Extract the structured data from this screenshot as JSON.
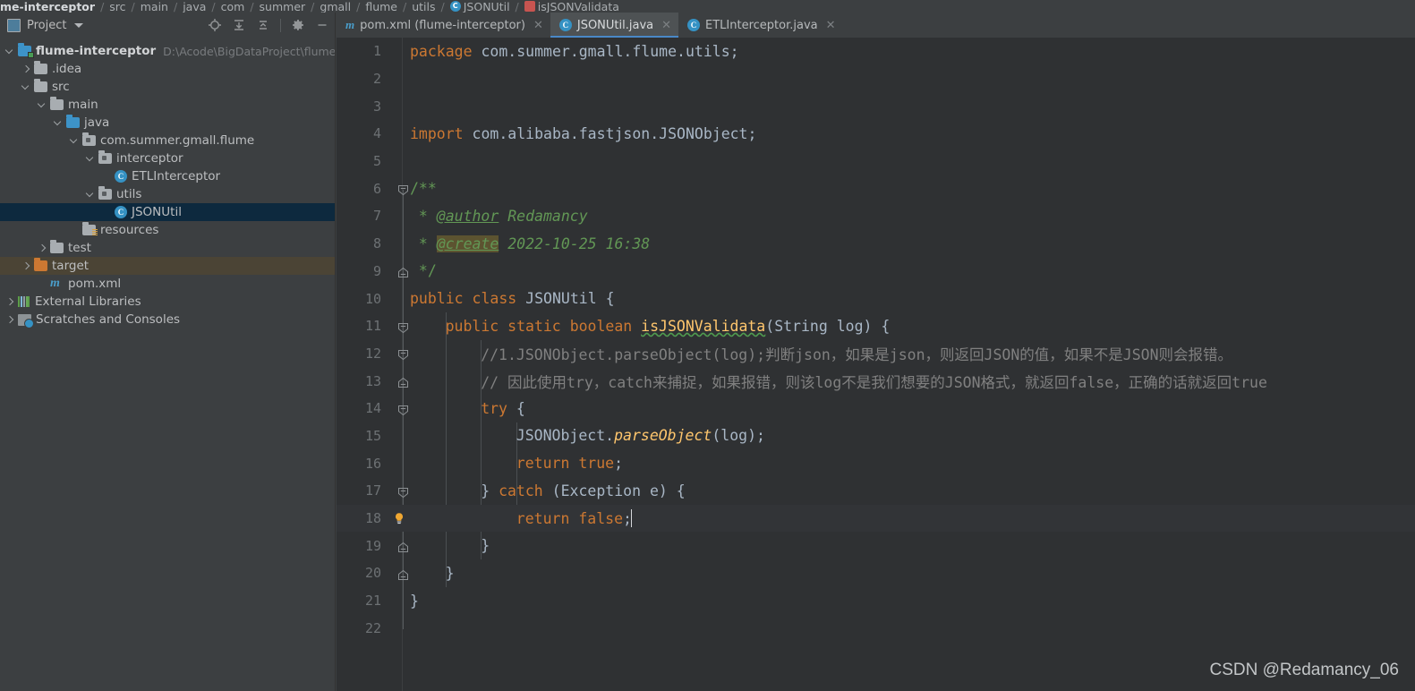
{
  "breadcrumb": {
    "items": [
      {
        "label": "me-interceptor",
        "bold": true,
        "icon": ""
      },
      {
        "label": "src",
        "icon": ""
      },
      {
        "label": "main",
        "icon": ""
      },
      {
        "label": "java",
        "icon": ""
      },
      {
        "label": "com",
        "icon": ""
      },
      {
        "label": "summer",
        "icon": ""
      },
      {
        "label": "gmall",
        "icon": ""
      },
      {
        "label": "flume",
        "icon": ""
      },
      {
        "label": "utils",
        "icon": ""
      },
      {
        "label": "JSONUtil",
        "icon": "class-icon"
      },
      {
        "label": "isJSONValidata",
        "icon": "method-icon"
      }
    ],
    "separator": "/"
  },
  "sidebar": {
    "panel_title": "Project",
    "tools": [
      {
        "name": "locate-icon",
        "title": "Select Opened File"
      },
      {
        "name": "expand-all-icon",
        "title": "Expand All"
      },
      {
        "name": "collapse-all-icon",
        "title": "Collapse All"
      },
      {
        "name": "gear-icon",
        "title": "Settings"
      },
      {
        "name": "minimize-icon",
        "title": "Hide"
      }
    ],
    "tree": [
      {
        "label": "flume-interceptor",
        "path": "D:\\Acode\\BigDataProject\\flume-interce",
        "indent": 0,
        "arrow": "down",
        "icon": "module-folder-icon",
        "bold": true,
        "state": "normal"
      },
      {
        "label": ".idea",
        "path": "",
        "indent": 1,
        "arrow": "right",
        "icon": "folder-icon",
        "bold": false,
        "state": "normal"
      },
      {
        "label": "src",
        "path": "",
        "indent": 1,
        "arrow": "down",
        "icon": "folder-icon",
        "bold": false,
        "state": "normal"
      },
      {
        "label": "main",
        "path": "",
        "indent": 2,
        "arrow": "down",
        "icon": "folder-icon",
        "bold": false,
        "state": "normal"
      },
      {
        "label": "java",
        "path": "",
        "indent": 3,
        "arrow": "down",
        "icon": "source-folder-icon",
        "bold": false,
        "state": "normal"
      },
      {
        "label": "com.summer.gmall.flume",
        "path": "",
        "indent": 4,
        "arrow": "down",
        "icon": "package-icon",
        "bold": false,
        "state": "normal"
      },
      {
        "label": "interceptor",
        "path": "",
        "indent": 5,
        "arrow": "down",
        "icon": "package-icon",
        "bold": false,
        "state": "normal"
      },
      {
        "label": "ETLInterceptor",
        "path": "",
        "indent": 6,
        "arrow": "none",
        "icon": "class-icon",
        "bold": false,
        "state": "normal"
      },
      {
        "label": "utils",
        "path": "",
        "indent": 5,
        "arrow": "down",
        "icon": "package-icon",
        "bold": false,
        "state": "normal"
      },
      {
        "label": "JSONUtil",
        "path": "",
        "indent": 6,
        "arrow": "none",
        "icon": "class-icon",
        "bold": false,
        "state": "selected"
      },
      {
        "label": "resources",
        "path": "",
        "indent": 4,
        "arrow": "none",
        "icon": "resources-folder-icon",
        "bold": false,
        "state": "normal"
      },
      {
        "label": "test",
        "path": "",
        "indent": 2,
        "arrow": "right",
        "icon": "folder-icon",
        "bold": false,
        "state": "normal"
      },
      {
        "label": "target",
        "path": "",
        "indent": 1,
        "arrow": "right",
        "icon": "target-folder-icon",
        "bold": false,
        "state": "context"
      },
      {
        "label": "pom.xml",
        "path": "",
        "indent": 2,
        "arrow": "none",
        "icon": "maven-icon",
        "bold": false,
        "state": "normal"
      },
      {
        "label": "External Libraries",
        "path": "",
        "indent": 0,
        "arrow": "right",
        "icon": "libraries-icon",
        "bold": false,
        "state": "normal"
      },
      {
        "label": "Scratches and Consoles",
        "path": "",
        "indent": 0,
        "arrow": "right",
        "icon": "scratches-icon",
        "bold": false,
        "state": "normal"
      }
    ]
  },
  "editor": {
    "tabs": [
      {
        "label": "pom.xml (flume-interceptor)",
        "icon": "maven-icon",
        "active": false,
        "closable": true
      },
      {
        "label": "JSONUtil.java",
        "icon": "class-icon",
        "active": true,
        "closable": true
      },
      {
        "label": "ETLInterceptor.java",
        "icon": "class-icon",
        "active": false,
        "closable": true
      }
    ],
    "current_line": 18,
    "caret_after": "return false;",
    "lines": [
      {
        "n": "1",
        "fold": "none",
        "text": "package com.summer.gmall.flume.utils;"
      },
      {
        "n": "2",
        "fold": "none",
        "text": ""
      },
      {
        "n": "3",
        "fold": "none",
        "text": ""
      },
      {
        "n": "4",
        "fold": "none",
        "text": "import com.alibaba.fastjson.JSONObject;"
      },
      {
        "n": "5",
        "fold": "none",
        "text": ""
      },
      {
        "n": "6",
        "fold": "start",
        "text": "/**"
      },
      {
        "n": "7",
        "fold": "none",
        "text": " * @author Redamancy"
      },
      {
        "n": "8",
        "fold": "none",
        "text": " * @create 2022-10-25 16:38"
      },
      {
        "n": "9",
        "fold": "end",
        "text": " */"
      },
      {
        "n": "10",
        "fold": "none",
        "text": "public class JSONUtil {"
      },
      {
        "n": "11",
        "fold": "start",
        "text": "    public static boolean isJSONValidata(String log) {"
      },
      {
        "n": "12",
        "fold": "start",
        "text": "        //1.JSONObject.parseObject(log);判断json，如果是json，则返回JSON的值，如果不是JSON则会报错。"
      },
      {
        "n": "13",
        "fold": "end",
        "text": "        // 因此使用try，catch来捕捉，如果报错，则该log不是我们想要的JSON格式，就返回false，正确的话就返回true"
      },
      {
        "n": "14",
        "fold": "start",
        "text": "        try {"
      },
      {
        "n": "15",
        "fold": "none",
        "text": "            JSONObject.parseObject(log);"
      },
      {
        "n": "16",
        "fold": "none",
        "text": "            return true;"
      },
      {
        "n": "17",
        "fold": "start",
        "text": "        } catch (Exception e) {"
      },
      {
        "n": "18",
        "fold": "none",
        "text": "            return false;"
      },
      {
        "n": "19",
        "fold": "end",
        "text": "        }"
      },
      {
        "n": "20",
        "fold": "end",
        "text": "    }"
      },
      {
        "n": "21",
        "fold": "none",
        "text": "}"
      },
      {
        "n": "22",
        "fold": "none",
        "text": ""
      }
    ],
    "intention_hint": "intention-bulb",
    "typo_word": "isJSONValidata"
  },
  "watermark": "CSDN @Redamancy_06",
  "colors": {
    "background": "#3c3f41",
    "editor_background": "#2f3133",
    "selection": "#0d293e",
    "context_row": "#4b4435",
    "keyword": "#cc7832",
    "comment": "#808080",
    "javadoc": "#629755",
    "method": "#ffc66d",
    "accent": "#4a88c7",
    "text": "#a9b7c6"
  }
}
